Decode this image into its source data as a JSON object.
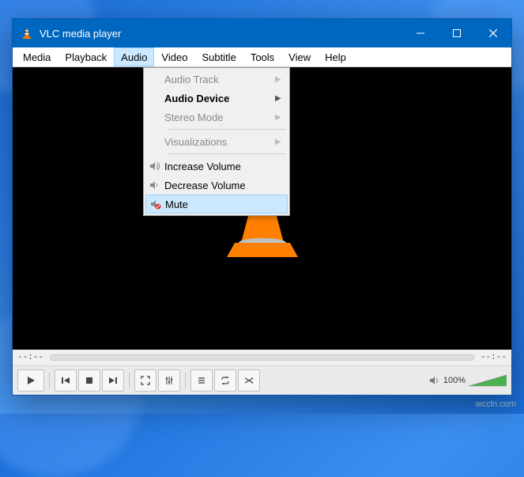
{
  "titlebar": {
    "title": "VLC media player"
  },
  "menubar": {
    "media": "Media",
    "playback": "Playback",
    "audio": "Audio",
    "video": "Video",
    "subtitle": "Subtitle",
    "tools": "Tools",
    "view": "View",
    "help": "Help"
  },
  "dropdown": {
    "audio_track": "Audio Track",
    "audio_device": "Audio Device",
    "stereo_mode": "Stereo Mode",
    "visualizations": "Visualizations",
    "increase_volume": "Increase Volume",
    "decrease_volume": "Decrease Volume",
    "mute": "Mute"
  },
  "seekbar": {
    "time_current": "--:--",
    "time_total": "--:--"
  },
  "controls": {
    "volume_pct": "100%"
  },
  "watermark": "wccln.com"
}
